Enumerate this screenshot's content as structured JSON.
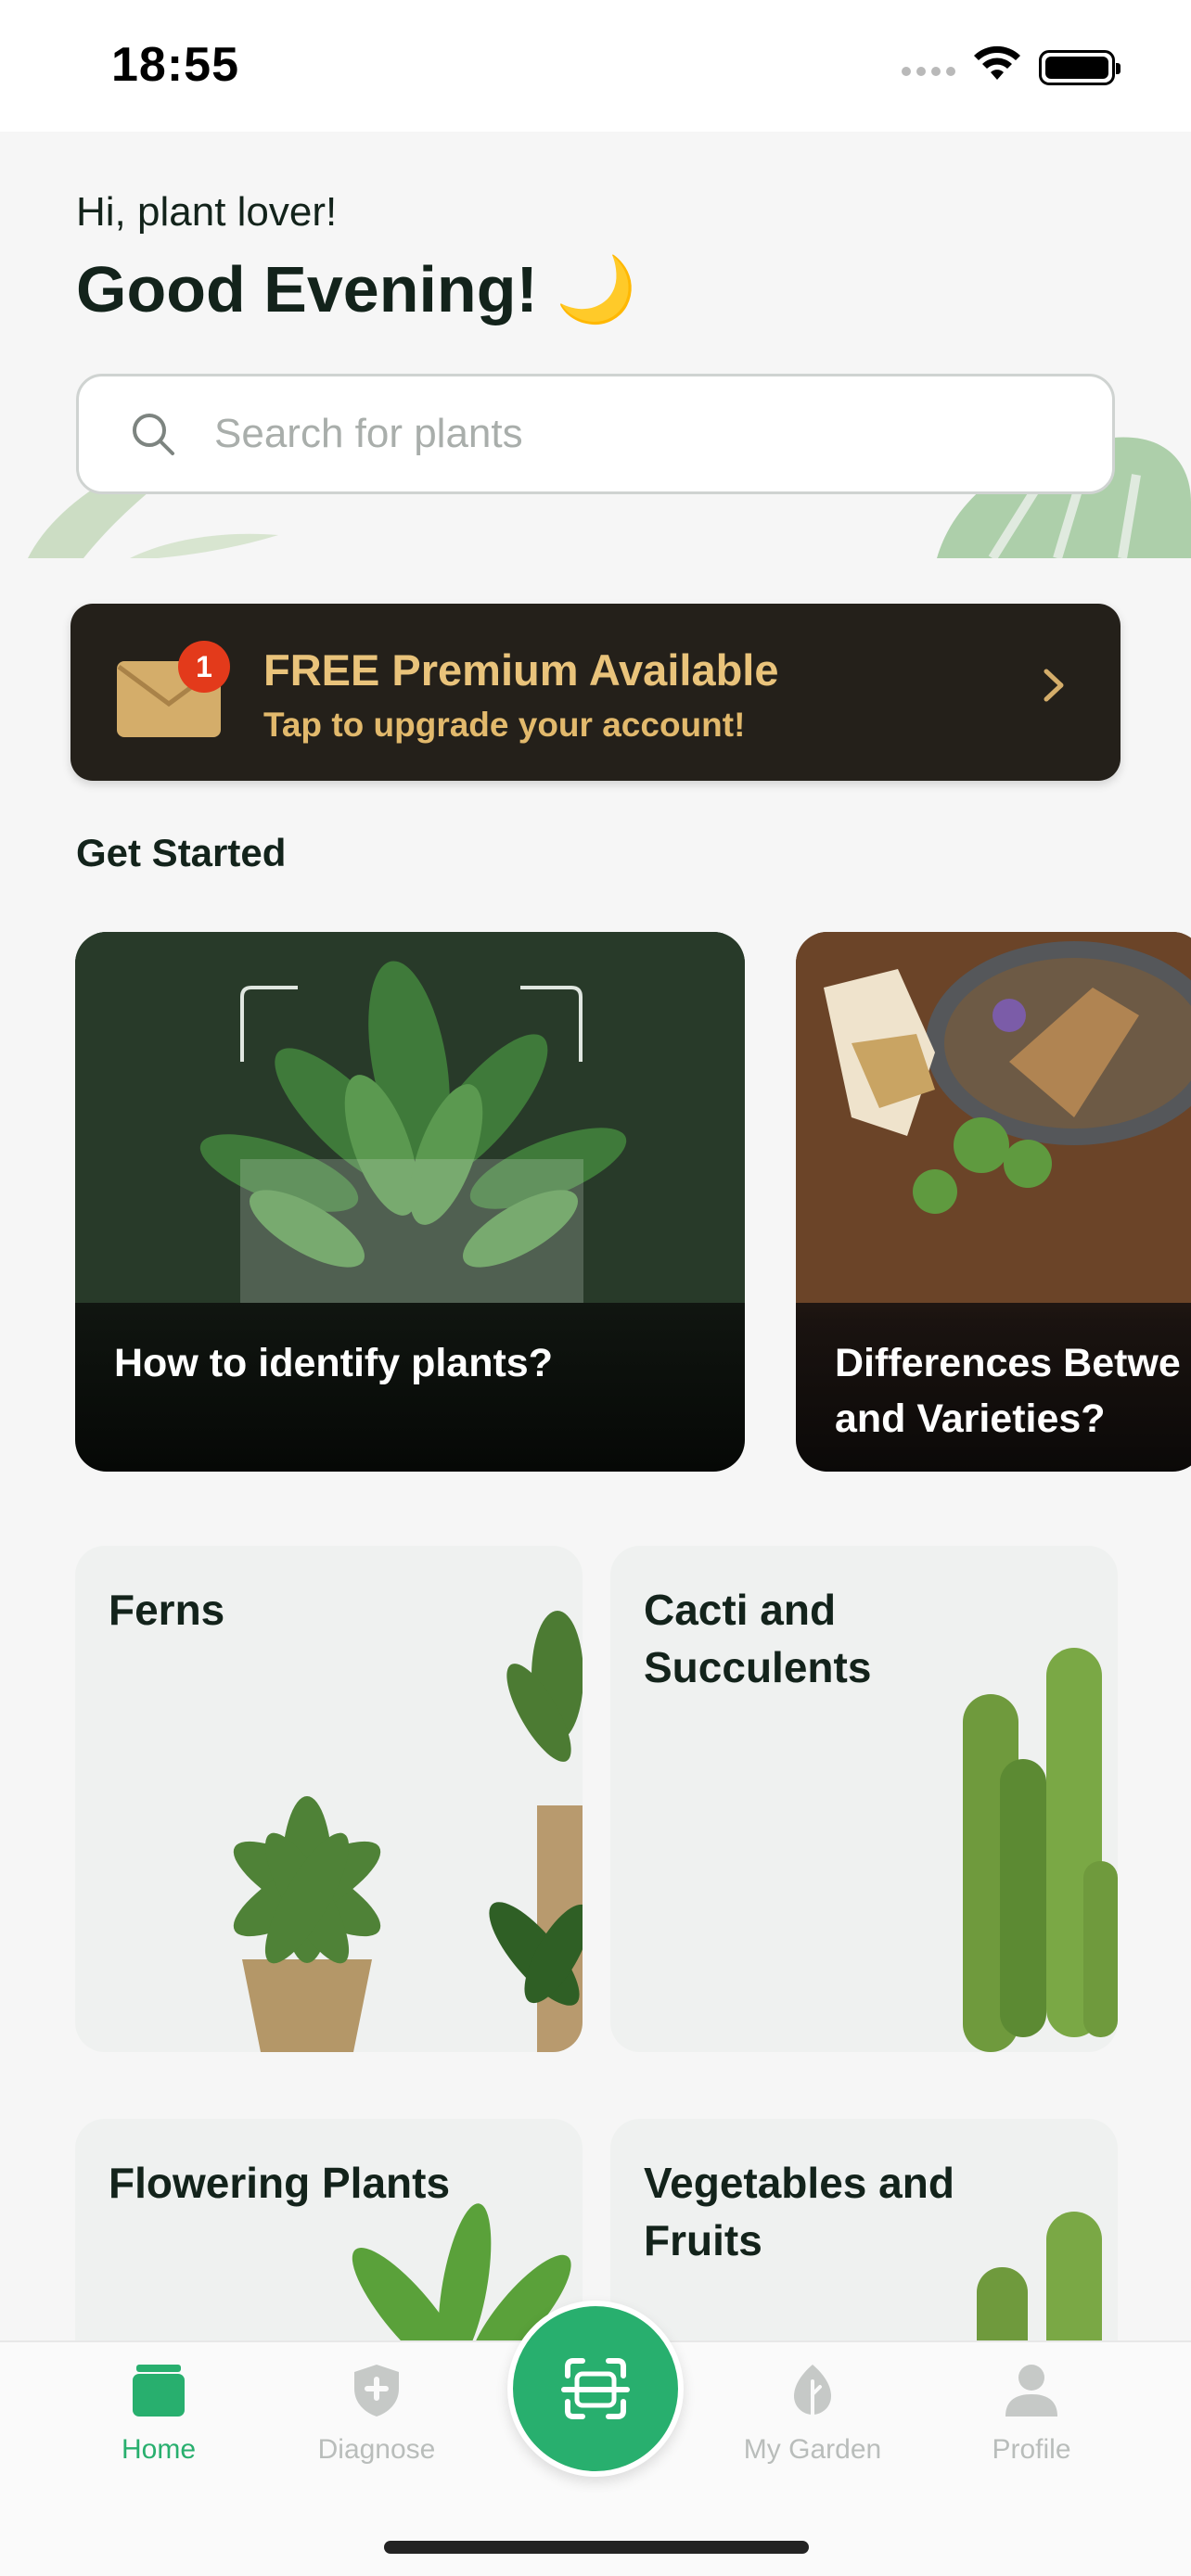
{
  "status_bar": {
    "time": "18:55"
  },
  "header": {
    "greeting": "Hi, plant lover!",
    "title": "Good Evening! 🌙",
    "search_placeholder": "Search for plants"
  },
  "premium_banner": {
    "badge_count": "1",
    "title": "FREE Premium Available",
    "subtitle": "Tap to upgrade your account!"
  },
  "get_started": {
    "title": "Get Started",
    "cards": [
      {
        "text": "How to identify plants?"
      },
      {
        "text_line1": "Differences Betwe",
        "text_line2": "and Varieties?"
      }
    ]
  },
  "categories": [
    {
      "line1": "Ferns",
      "line2": ""
    },
    {
      "line1": "Cacti and",
      "line2": "Succulents"
    },
    {
      "line1": "Flowering Plants",
      "line2": ""
    },
    {
      "line1": "Vegetables and",
      "line2": "Fruits"
    }
  ],
  "tab_bar": {
    "tabs": [
      {
        "label": "Home",
        "icon": "home-icon",
        "active": true
      },
      {
        "label": "Diagnose",
        "icon": "shield-plus-icon",
        "active": false
      },
      {
        "label": "My Garden",
        "icon": "leaf-icon",
        "active": false
      },
      {
        "label": "Profile",
        "icon": "person-icon",
        "active": false
      }
    ],
    "scan_icon": "scan-icon"
  },
  "colors": {
    "accent": "#28af6e",
    "premium_bg": "#24201a",
    "premium_text": "#e9c37b",
    "badge": "#e33a1b"
  }
}
